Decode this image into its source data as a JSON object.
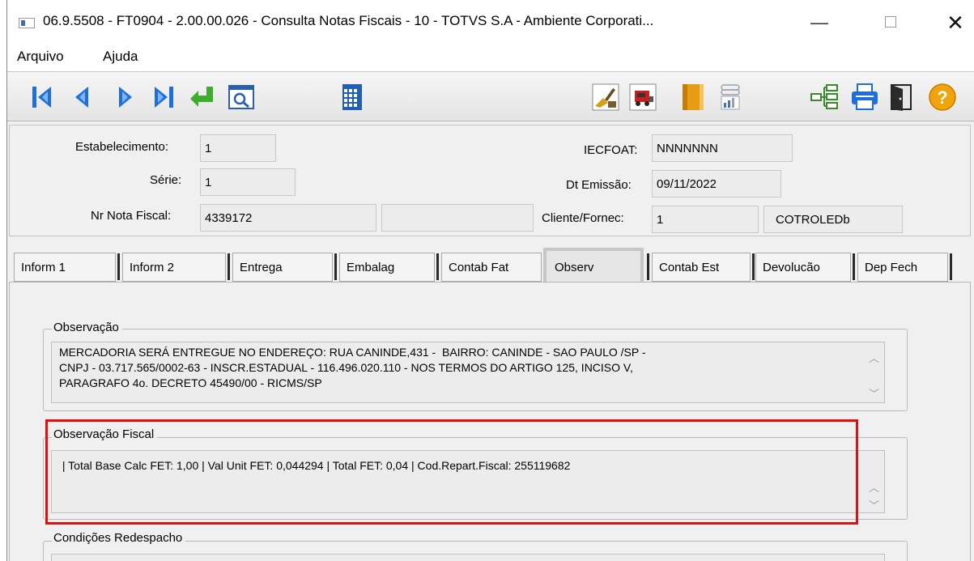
{
  "window": {
    "title": "06.9.5508 - FT0904 - 2.00.00.026 - Consulta Notas Fiscais - 10 - TOTVS S.A - Ambiente Corporati...",
    "minimize": "—",
    "close": "✕"
  },
  "menu": [
    "Arquivo",
    "Ajuda"
  ],
  "toolbar": {
    "nav_icons": [
      "first-record-icon",
      "previous-record-icon",
      "next-record-icon",
      "last-record-icon",
      "return-icon",
      "search-zoom-icon",
      "calendar-grid-icon"
    ],
    "action_icons": [
      "clean-icon",
      "truck-icon",
      "book-icon",
      "chart-icon",
      "tree-icon",
      "printer-icon",
      "exit-door-icon",
      "help-icon"
    ]
  },
  "header": {
    "estabelecimento_label": "Estabelecimento:",
    "estabelecimento_value": "1",
    "iecfoat_label": "IECFOAT:",
    "iecfoat_value": "NNNNNNN",
    "serie_label": "Série:",
    "serie_value": "1",
    "dt_emissao_label": "Dt Emissão:",
    "dt_emissao_value": "09/11/2022",
    "nr_nota_label": "Nr Nota Fiscal:",
    "nr_nota_value": "4339172",
    "nr_nota_extra": "",
    "cliente_label": "Cliente/Fornec:",
    "cliente_value": "1",
    "cliente_nome": "COTROLEDb"
  },
  "tabs": [
    "Inform 1",
    "Inform 2",
    "Entrega",
    "Embalag",
    "Contab Fat",
    "Observ",
    "Contab Est",
    "Devolucão",
    "Dep Fech"
  ],
  "active_tab": "Observ",
  "observacao": {
    "title": "Observação",
    "lines": [
      "MERCADORIA SERÁ ENTREGUE NO ENDEREÇO: RUA CANINDE,431 -  BAIRRO: CANINDE - SAO PAULO /SP -",
      "CNPJ - 03.717.565/0002-63 - INSCR.ESTADUAL - 116.496.020.110 - NOS TERMOS DO ARTIGO 125, INCISO V,",
      "PARAGRAFO 4o. DECRETO 45490/00 - RICMS/SP"
    ]
  },
  "observacao_fiscal": {
    "title": "Observação Fiscal",
    "text": " | Total Base Calc FET: 1,00 | Val Unit FET: 0,044294 | Total FET: 0,04 | Cod.Repart.Fiscal: 255119682"
  },
  "condicoes_redespacho": {
    "title": "Condições Redespacho"
  },
  "colors": {
    "highlight": "#e01010",
    "nav_blue": "#1e6fd9",
    "return_green": "#3cae2c"
  }
}
